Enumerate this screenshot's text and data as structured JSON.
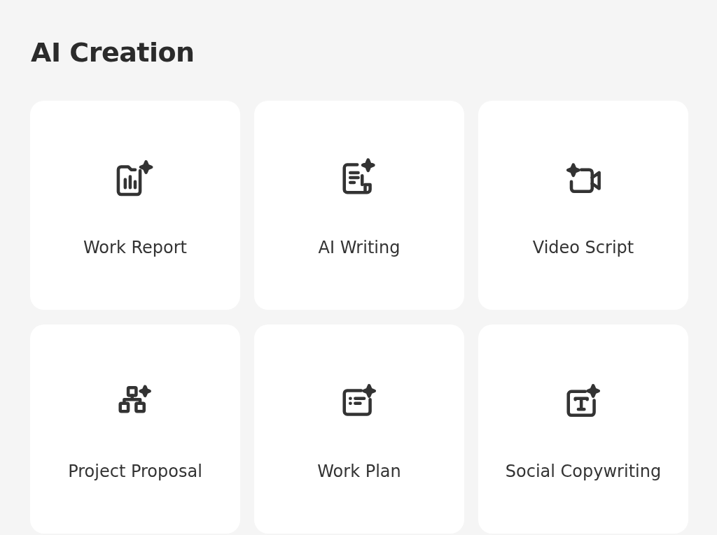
{
  "title": "AI Creation",
  "cards": [
    {
      "label": "Work Report",
      "kind": "report"
    },
    {
      "label": "AI Writing",
      "kind": "writing"
    },
    {
      "label": "Video Script",
      "kind": "video"
    },
    {
      "label": "Project Proposal",
      "kind": "proposal"
    },
    {
      "label": "Work Plan",
      "kind": "plan"
    },
    {
      "label": "Social Copywriting",
      "kind": "copywriting"
    }
  ]
}
